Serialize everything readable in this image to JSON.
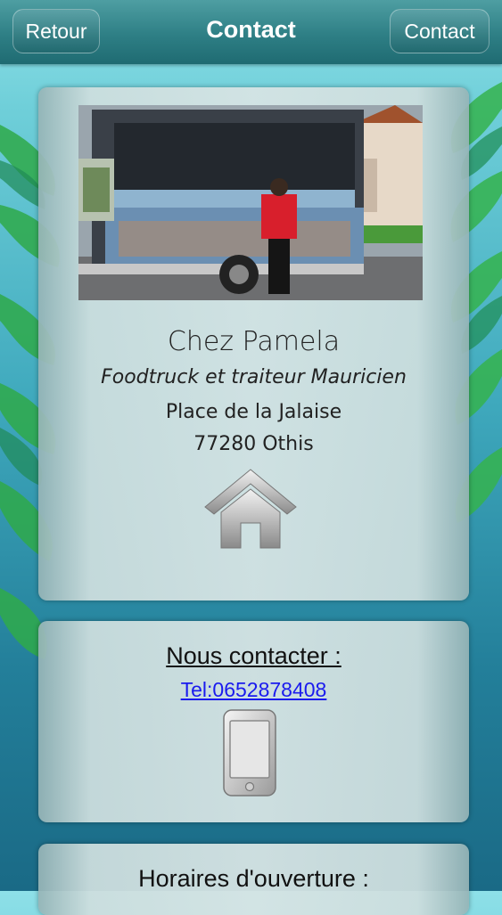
{
  "header": {
    "back_label": "Retour",
    "title": "Contact",
    "contact_label": "Contact"
  },
  "business": {
    "name": "Chez Pamela",
    "tagline": "Foodtruck et traiteur Mauricien",
    "address_line1": "Place de la Jalaise",
    "address_line2": "77280 Othis"
  },
  "contact": {
    "heading": "Nous contacter :",
    "phone_link": "Tel:0652878408"
  },
  "hours": {
    "heading": "Horaires d'ouverture :"
  },
  "icons": {
    "home": "home-icon",
    "phone": "smartphone-icon",
    "leaves": "palm-leaf-icon"
  },
  "colors": {
    "header": "#2e7f85",
    "link": "#1a1aee",
    "background_top": "#8ee0e8",
    "background_bottom": "#1a6a86"
  }
}
